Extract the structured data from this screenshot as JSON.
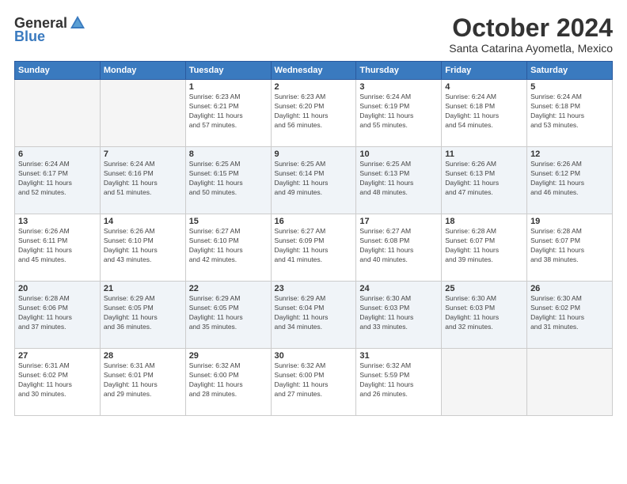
{
  "header": {
    "logo_general": "General",
    "logo_blue": "Blue",
    "month_title": "October 2024",
    "location": "Santa Catarina Ayometla, Mexico"
  },
  "weekdays": [
    "Sunday",
    "Monday",
    "Tuesday",
    "Wednesday",
    "Thursday",
    "Friday",
    "Saturday"
  ],
  "weeks": [
    [
      {
        "day": "",
        "info": ""
      },
      {
        "day": "",
        "info": ""
      },
      {
        "day": "1",
        "info": "Sunrise: 6:23 AM\nSunset: 6:21 PM\nDaylight: 11 hours\nand 57 minutes."
      },
      {
        "day": "2",
        "info": "Sunrise: 6:23 AM\nSunset: 6:20 PM\nDaylight: 11 hours\nand 56 minutes."
      },
      {
        "day": "3",
        "info": "Sunrise: 6:24 AM\nSunset: 6:19 PM\nDaylight: 11 hours\nand 55 minutes."
      },
      {
        "day": "4",
        "info": "Sunrise: 6:24 AM\nSunset: 6:18 PM\nDaylight: 11 hours\nand 54 minutes."
      },
      {
        "day": "5",
        "info": "Sunrise: 6:24 AM\nSunset: 6:18 PM\nDaylight: 11 hours\nand 53 minutes."
      }
    ],
    [
      {
        "day": "6",
        "info": "Sunrise: 6:24 AM\nSunset: 6:17 PM\nDaylight: 11 hours\nand 52 minutes."
      },
      {
        "day": "7",
        "info": "Sunrise: 6:24 AM\nSunset: 6:16 PM\nDaylight: 11 hours\nand 51 minutes."
      },
      {
        "day": "8",
        "info": "Sunrise: 6:25 AM\nSunset: 6:15 PM\nDaylight: 11 hours\nand 50 minutes."
      },
      {
        "day": "9",
        "info": "Sunrise: 6:25 AM\nSunset: 6:14 PM\nDaylight: 11 hours\nand 49 minutes."
      },
      {
        "day": "10",
        "info": "Sunrise: 6:25 AM\nSunset: 6:13 PM\nDaylight: 11 hours\nand 48 minutes."
      },
      {
        "day": "11",
        "info": "Sunrise: 6:26 AM\nSunset: 6:13 PM\nDaylight: 11 hours\nand 47 minutes."
      },
      {
        "day": "12",
        "info": "Sunrise: 6:26 AM\nSunset: 6:12 PM\nDaylight: 11 hours\nand 46 minutes."
      }
    ],
    [
      {
        "day": "13",
        "info": "Sunrise: 6:26 AM\nSunset: 6:11 PM\nDaylight: 11 hours\nand 45 minutes."
      },
      {
        "day": "14",
        "info": "Sunrise: 6:26 AM\nSunset: 6:10 PM\nDaylight: 11 hours\nand 43 minutes."
      },
      {
        "day": "15",
        "info": "Sunrise: 6:27 AM\nSunset: 6:10 PM\nDaylight: 11 hours\nand 42 minutes."
      },
      {
        "day": "16",
        "info": "Sunrise: 6:27 AM\nSunset: 6:09 PM\nDaylight: 11 hours\nand 41 minutes."
      },
      {
        "day": "17",
        "info": "Sunrise: 6:27 AM\nSunset: 6:08 PM\nDaylight: 11 hours\nand 40 minutes."
      },
      {
        "day": "18",
        "info": "Sunrise: 6:28 AM\nSunset: 6:07 PM\nDaylight: 11 hours\nand 39 minutes."
      },
      {
        "day": "19",
        "info": "Sunrise: 6:28 AM\nSunset: 6:07 PM\nDaylight: 11 hours\nand 38 minutes."
      }
    ],
    [
      {
        "day": "20",
        "info": "Sunrise: 6:28 AM\nSunset: 6:06 PM\nDaylight: 11 hours\nand 37 minutes."
      },
      {
        "day": "21",
        "info": "Sunrise: 6:29 AM\nSunset: 6:05 PM\nDaylight: 11 hours\nand 36 minutes."
      },
      {
        "day": "22",
        "info": "Sunrise: 6:29 AM\nSunset: 6:05 PM\nDaylight: 11 hours\nand 35 minutes."
      },
      {
        "day": "23",
        "info": "Sunrise: 6:29 AM\nSunset: 6:04 PM\nDaylight: 11 hours\nand 34 minutes."
      },
      {
        "day": "24",
        "info": "Sunrise: 6:30 AM\nSunset: 6:03 PM\nDaylight: 11 hours\nand 33 minutes."
      },
      {
        "day": "25",
        "info": "Sunrise: 6:30 AM\nSunset: 6:03 PM\nDaylight: 11 hours\nand 32 minutes."
      },
      {
        "day": "26",
        "info": "Sunrise: 6:30 AM\nSunset: 6:02 PM\nDaylight: 11 hours\nand 31 minutes."
      }
    ],
    [
      {
        "day": "27",
        "info": "Sunrise: 6:31 AM\nSunset: 6:02 PM\nDaylight: 11 hours\nand 30 minutes."
      },
      {
        "day": "28",
        "info": "Sunrise: 6:31 AM\nSunset: 6:01 PM\nDaylight: 11 hours\nand 29 minutes."
      },
      {
        "day": "29",
        "info": "Sunrise: 6:32 AM\nSunset: 6:00 PM\nDaylight: 11 hours\nand 28 minutes."
      },
      {
        "day": "30",
        "info": "Sunrise: 6:32 AM\nSunset: 6:00 PM\nDaylight: 11 hours\nand 27 minutes."
      },
      {
        "day": "31",
        "info": "Sunrise: 6:32 AM\nSunset: 5:59 PM\nDaylight: 11 hours\nand 26 minutes."
      },
      {
        "day": "",
        "info": ""
      },
      {
        "day": "",
        "info": ""
      }
    ]
  ]
}
